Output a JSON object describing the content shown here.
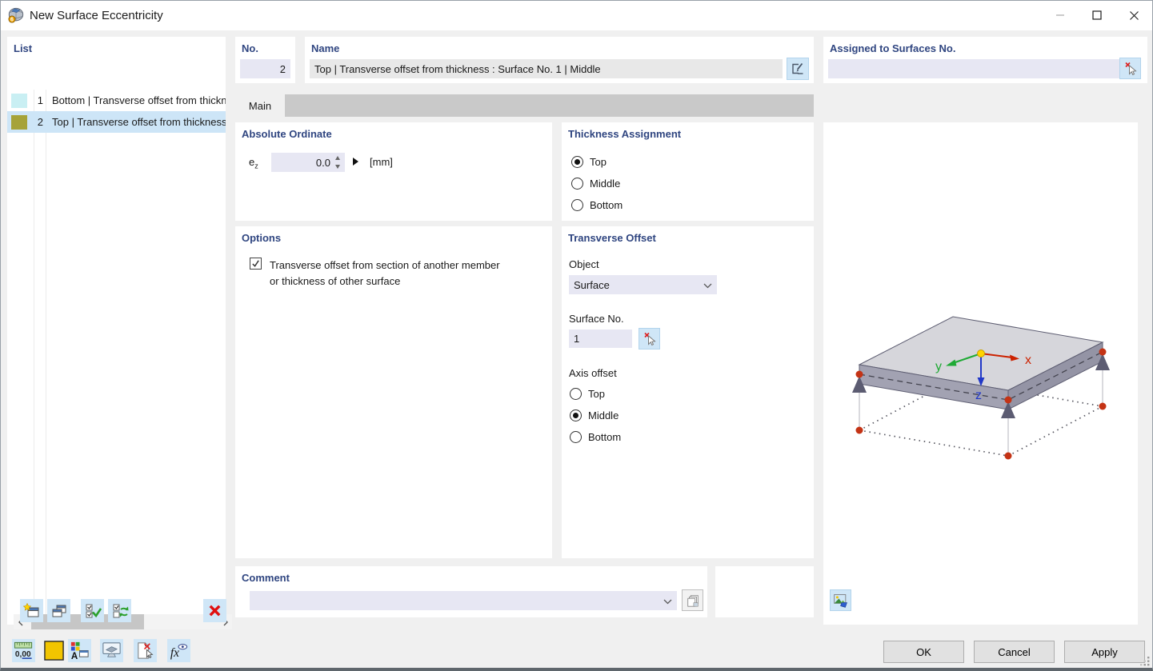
{
  "window": {
    "title": "New Surface Eccentricity"
  },
  "list": {
    "title": "List",
    "items": [
      {
        "no": "1",
        "label": "Bottom | Transverse offset from thickne",
        "swatch": "#c9eff3",
        "selected": false
      },
      {
        "no": "2",
        "label": "Top | Transverse offset from thickness",
        "swatch": "#a6a339",
        "selected": true
      }
    ],
    "toolbar_icons": [
      "new-entry-icon",
      "copy-entry-icon",
      "select-all-icon",
      "invert-selection-icon",
      "delete-entry-icon"
    ]
  },
  "header": {
    "no_label": "No.",
    "no_value": "2",
    "name_label": "Name",
    "name_value": "Top | Transverse offset from thickness : Surface No. 1 | Middle",
    "assigned_label": "Assigned to Surfaces No.",
    "assigned_value": ""
  },
  "tab": {
    "label": "Main"
  },
  "absolute_ordinate": {
    "title": "Absolute Ordinate",
    "symbol": "e",
    "symbol_sub": "z",
    "value": "0.0",
    "unit": "[mm]"
  },
  "thickness_assignment": {
    "title": "Thickness Assignment",
    "options": [
      "Top",
      "Middle",
      "Bottom"
    ],
    "selected": "Top"
  },
  "options": {
    "title": "Options",
    "checkbox_line1": "Transverse offset from section of another member",
    "checkbox_line2": "or thickness of other surface",
    "checked": true
  },
  "transverse_offset": {
    "title": "Transverse Offset",
    "object_label": "Object",
    "object_value": "Surface",
    "surface_no_label": "Surface No.",
    "surface_no_value": "1",
    "axis_offset_label": "Axis offset",
    "options": [
      "Top",
      "Middle",
      "Bottom"
    ],
    "selected": "Middle"
  },
  "comment": {
    "title": "Comment",
    "value": ""
  },
  "diagram": {
    "axes": {
      "x": "x",
      "y": "y",
      "z": "z"
    },
    "colors": {
      "x_axis": "#cc2200",
      "y_axis": "#1faa35",
      "z_axis": "#2138c8",
      "origin_node": "#ffd400",
      "corner_node": "#c43315",
      "plate_top": "#d6d6db",
      "plate_side_front": "#a2a2b2",
      "plate_side_right": "#9494a5",
      "support": "#5c5c72"
    }
  },
  "actions": {
    "ok": "OK",
    "cancel": "Cancel",
    "apply": "Apply"
  },
  "icons": {
    "app": "surface-eccentricity-app-icon",
    "titlebar": [
      "minimize-icon",
      "maximize-icon",
      "close-icon"
    ],
    "name_edit": "rename-pencil-icon",
    "assigned_pick": "pick-cursor-clear-icon",
    "surface_pick": "pick-cursor-clear-icon",
    "spinner": "up-down-spinner-icon",
    "value_options": "right-arrow-icon",
    "comment_presets": "stacked-comments-icon",
    "footer": [
      "units-icon",
      "color-swatch-icon",
      "display-properties-icon",
      "rendering-icon",
      "remove-assignment-icon",
      "formula-fx-icon"
    ],
    "diagram_corner": "save-image-icon"
  }
}
